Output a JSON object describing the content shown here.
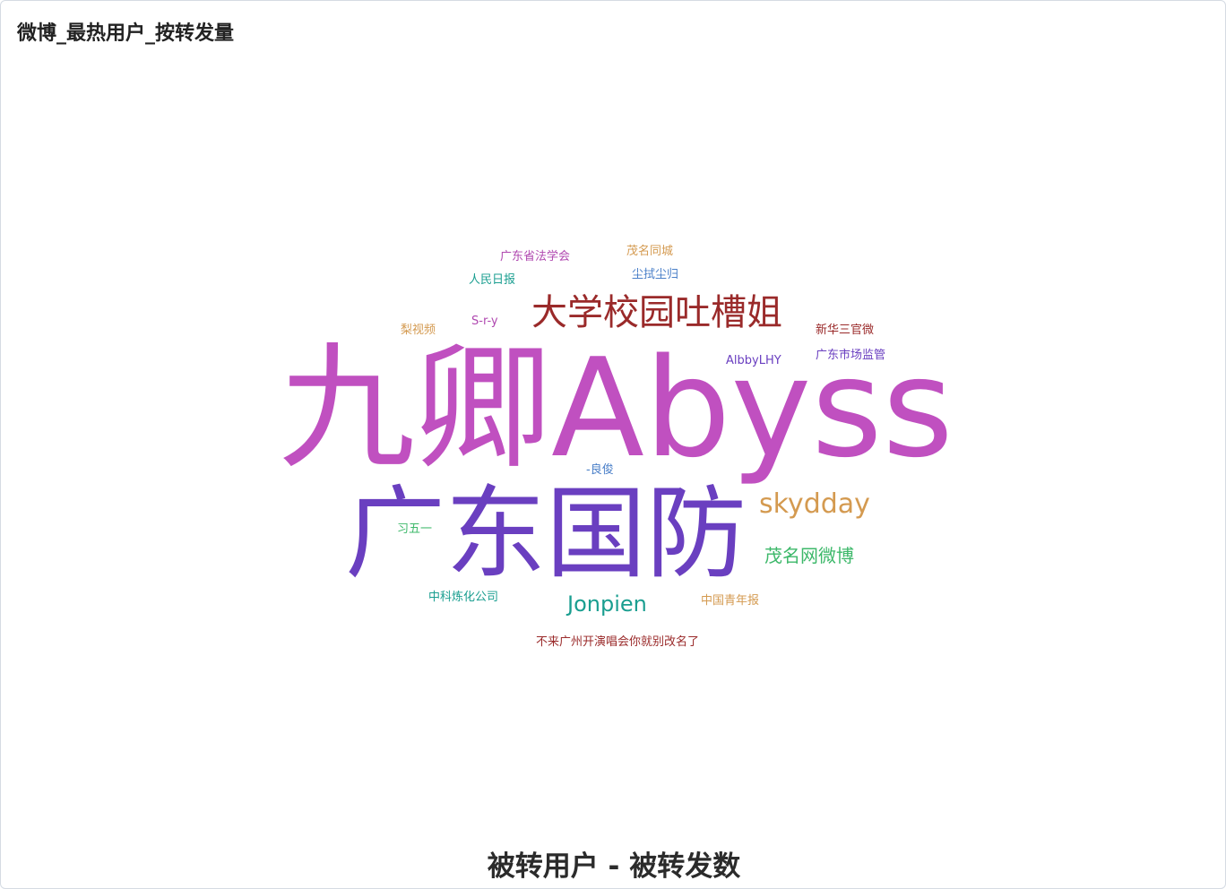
{
  "panel": {
    "title": "微博_最热用户_按转发量"
  },
  "chart_data": {
    "type": "wordcloud",
    "caption": "被转用户 - 被转发数",
    "words": [
      {
        "text": "九卿Abyss",
        "weight": 100,
        "color": "#c050c0"
      },
      {
        "text": "广东国防",
        "weight": 75,
        "color": "#6a3fc0"
      },
      {
        "text": "大学校园吐槽姐",
        "weight": 35,
        "color": "#9a2a2a"
      },
      {
        "text": "skydday",
        "weight": 25,
        "color": "#d49a50"
      },
      {
        "text": "茂名网微博",
        "weight": 17,
        "color": "#3db86a"
      },
      {
        "text": "Jonpien",
        "weight": 20,
        "color": "#1a9e90"
      },
      {
        "text": "广东省法学会",
        "weight": 8,
        "color": "#b048b0"
      },
      {
        "text": "茂名同城",
        "weight": 8,
        "color": "#d49a50"
      },
      {
        "text": "人民日报",
        "weight": 8,
        "color": "#1a9e90"
      },
      {
        "text": "尘拭尘归",
        "weight": 8,
        "color": "#4a7fc8"
      },
      {
        "text": "梨视频",
        "weight": 8,
        "color": "#d49a50"
      },
      {
        "text": "S-r-y",
        "weight": 8,
        "color": "#b048b0"
      },
      {
        "text": "新华三官微",
        "weight": 8,
        "color": "#9a2a2a"
      },
      {
        "text": "AlbbyLHY",
        "weight": 8,
        "color": "#6a3fc0"
      },
      {
        "text": "广东市场监管",
        "weight": 8,
        "color": "#6a3fc0"
      },
      {
        "text": "-良俊",
        "weight": 8,
        "color": "#4a7fc8"
      },
      {
        "text": "习五一",
        "weight": 8,
        "color": "#3db86a"
      },
      {
        "text": "中科炼化公司",
        "weight": 8,
        "color": "#1a9e90"
      },
      {
        "text": "中国青年报",
        "weight": 8,
        "color": "#d49a50"
      },
      {
        "text": "不来广州开演唱会你就别改名了",
        "weight": 8,
        "color": "#9a2a2a"
      }
    ]
  }
}
